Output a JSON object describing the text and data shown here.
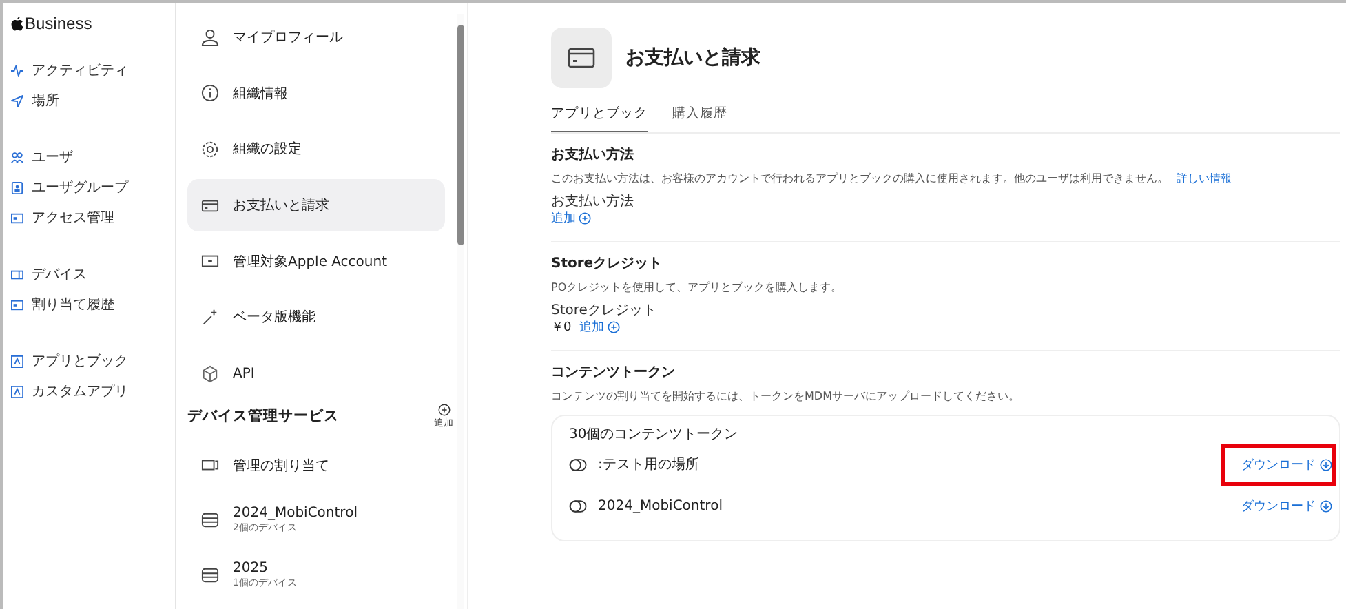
{
  "brand": {
    "text": "Business"
  },
  "nav_groups": [
    {
      "items": [
        {
          "label": "アクティビティ"
        },
        {
          "label": "場所"
        }
      ]
    },
    {
      "items": [
        {
          "label": "ユーザ"
        },
        {
          "label": "ユーザグループ"
        },
        {
          "label": "アクセス管理"
        }
      ]
    },
    {
      "items": [
        {
          "label": "デバイス"
        },
        {
          "label": "割り当て履歴"
        }
      ]
    },
    {
      "items": [
        {
          "label": "アプリとブック"
        },
        {
          "label": "カスタムアプリ"
        }
      ]
    }
  ],
  "settings_menu": [
    {
      "label": "マイプロフィール",
      "selected": false
    },
    {
      "label": "組織情報",
      "selected": false
    },
    {
      "label": "組織の設定",
      "selected": false
    },
    {
      "label": "お支払いと請求",
      "selected": true
    },
    {
      "label": "管理対象Apple Account",
      "selected": false
    },
    {
      "label": "ベータ版機能",
      "selected": false
    },
    {
      "label": "API",
      "selected": false
    }
  ],
  "device_services": {
    "title": "デバイス管理サービス",
    "add_label": "追加",
    "items": [
      {
        "label": "管理の割り当て"
      },
      {
        "label": "2024_MobiControl",
        "subtitle": "2個のデバイス"
      },
      {
        "label": "2025",
        "subtitle": "1個のデバイス"
      }
    ]
  },
  "page": {
    "title": "お支払いと請求",
    "tabs": [
      {
        "label": "アプリとブック",
        "selected": true
      },
      {
        "label": "購入履歴",
        "selected": false
      }
    ],
    "payment": {
      "title": "お支払い方法",
      "description": "このお支払い方法は、お客様のアカウントで行われるアプリとブックの購入に使用されます。他のユーザは利用できません。",
      "link": "詳しい情報",
      "field_label": "お支払い方法",
      "add_label": "追加"
    },
    "store_credit": {
      "title": "Storeクレジット",
      "description": "POクレジットを使用して、アプリとブックを購入します。",
      "field_label": "Storeクレジット",
      "amount": "￥0",
      "add_label": "追加"
    },
    "content_tokens": {
      "title": "コンテンツトークン",
      "description": "コンテンツの割り当てを開始するには、トークンをMDMサーバにアップロードしてください。",
      "count_label": "30個のコンテンツトークン",
      "tokens": [
        {
          "name": ":テスト用の場所",
          "action": "ダウンロード",
          "highlighted": true
        },
        {
          "name": "2024_MobiControl",
          "action": "ダウンロード",
          "highlighted": false
        }
      ]
    }
  }
}
